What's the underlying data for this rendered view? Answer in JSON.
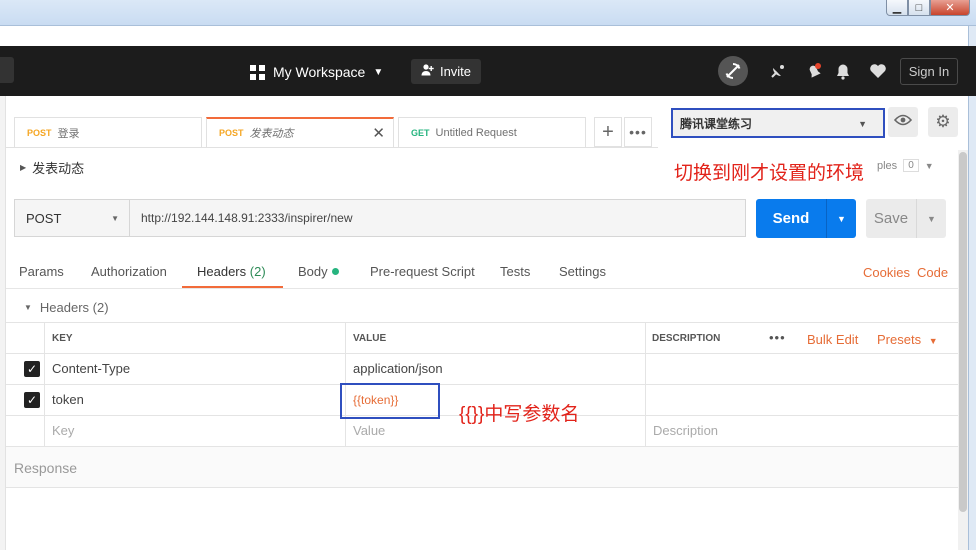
{
  "window": {
    "controls": {
      "minimize": "▁",
      "maximize": "□",
      "close": "✕"
    }
  },
  "header": {
    "workspace_label": "My Workspace",
    "invite_label": "Invite",
    "sign_in_label": "Sign In",
    "icons": [
      "sync-off-icon",
      "satellite-icon",
      "notification-bell-icon",
      "bell-icon",
      "heart-icon"
    ]
  },
  "tabs": [
    {
      "method": "POST",
      "label": "登录",
      "method_color": "#f5a623",
      "active": false
    },
    {
      "method": "POST",
      "label": "发表动态",
      "method_color": "#f5a623",
      "active": true
    },
    {
      "method": "GET",
      "label": "Untitled Request",
      "method_color": "#26b47f",
      "active": false
    }
  ],
  "tab_actions": {
    "add": "+",
    "more": "•••",
    "close": "✕"
  },
  "environment": {
    "selected": "腾讯课堂练习",
    "annotation": "切换到刚才设置的环境"
  },
  "examples": {
    "label": "ples",
    "count": "0"
  },
  "request": {
    "name": "发表动态",
    "method": "POST",
    "url": "http://192.144.148.91:2333/inspirer/new",
    "send_label": "Send",
    "save_label": "Save"
  },
  "subtabs": {
    "params": "Params",
    "authorization": "Authorization",
    "headers": "Headers",
    "headers_count": "(2)",
    "body": "Body",
    "pre_request": "Pre-request Script",
    "tests": "Tests",
    "settings": "Settings",
    "cookies": "Cookies",
    "code": "Code"
  },
  "headers_section": {
    "title": "Headers (2)",
    "columns": {
      "key": "KEY",
      "value": "VALUE",
      "description": "DESCRIPTION"
    },
    "actions": {
      "more": "•••",
      "bulk_edit": "Bulk Edit",
      "presets": "Presets"
    },
    "rows": [
      {
        "key": "Content-Type",
        "value": "application/json",
        "checked": true
      },
      {
        "key": "token",
        "value": "{{token}}",
        "checked": true
      }
    ],
    "placeholders": {
      "key": "Key",
      "value": "Value",
      "description": "Description"
    },
    "annotation": "{{}}中写参数名"
  },
  "response": {
    "label": "Response"
  }
}
